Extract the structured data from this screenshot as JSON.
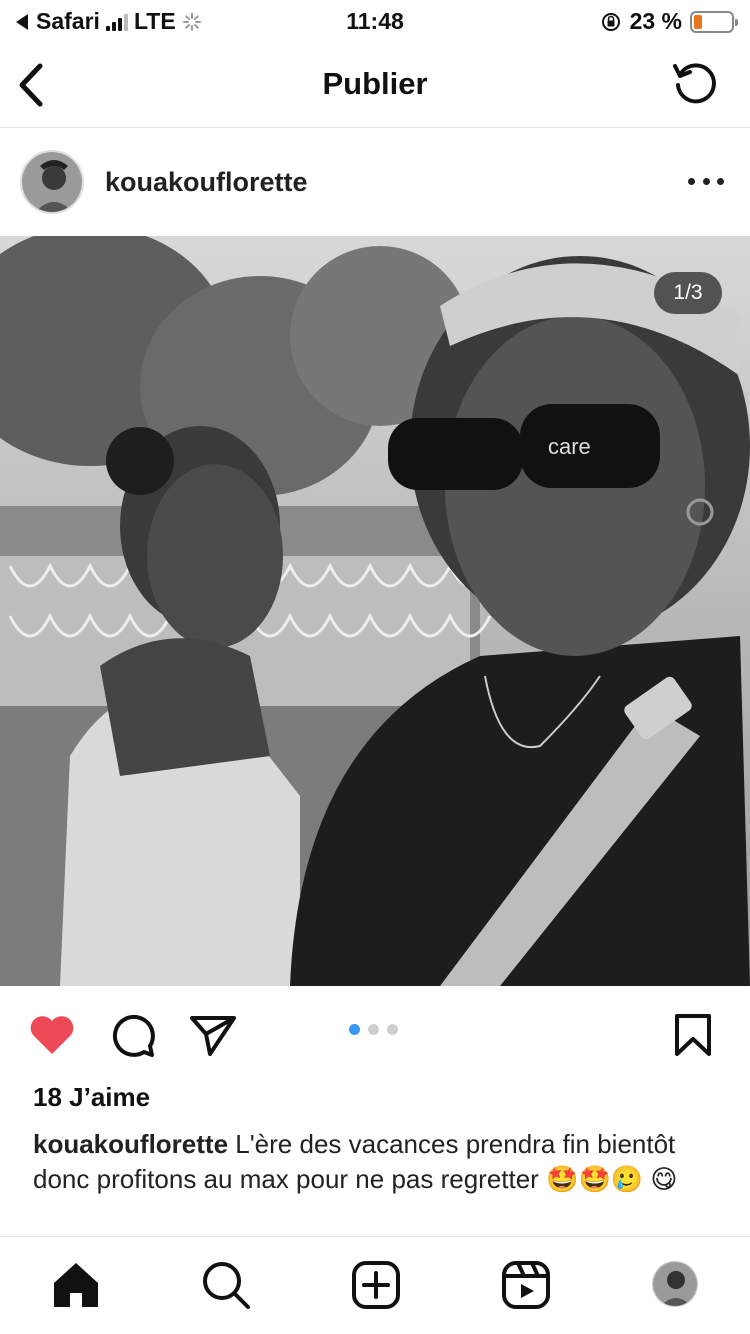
{
  "status_bar": {
    "back_app": "Safari",
    "network": "LTE",
    "time": "11:48",
    "battery": "23 %",
    "battery_level": 0.23
  },
  "header": {
    "title": "Publier",
    "back_icon": "chevron-left-icon",
    "refresh_icon": "refresh-icon"
  },
  "post": {
    "username": "kouakouflorette",
    "more_icon": "more-horizontal-icon",
    "image_counter": "1/3",
    "image_glasses_text": "care",
    "carousel": {
      "count": 3,
      "active": 0
    },
    "likes": "18 J’aime",
    "caption_user": "kouakouflorette",
    "caption_text": " L'ère des vacances prendra fin bientôt donc profitons au max pour ne pas regretter 🤩🤩🥲 😋",
    "liked": true,
    "colors": {
      "heart": "#ed4956",
      "dot_active": "#3897f0",
      "dot_inactive": "#cfcfcf"
    }
  },
  "tabbar": {
    "items": [
      "home-icon",
      "search-icon",
      "create-icon",
      "reels-icon",
      "profile-avatar"
    ]
  }
}
